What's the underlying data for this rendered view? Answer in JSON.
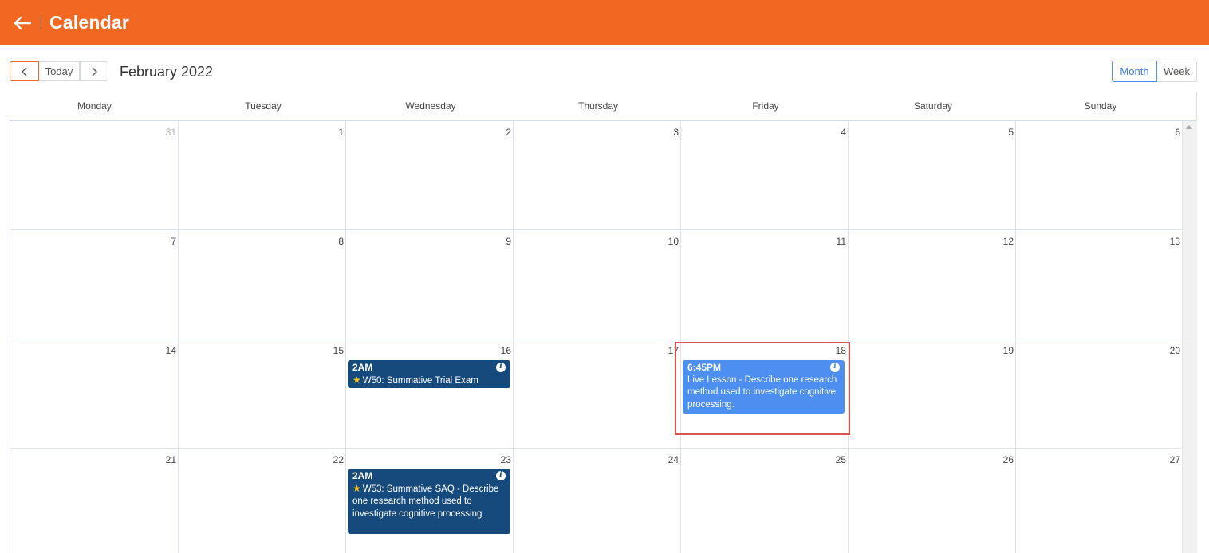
{
  "header": {
    "title": "Calendar",
    "back_icon": "arrow-left-icon",
    "background": "#f26722"
  },
  "toolbar": {
    "prev_icon": "chevron-left-icon",
    "today_label": "Today",
    "next_icon": "chevron-right-icon",
    "month_title": "February 2022",
    "view_month_label": "Month",
    "view_week_label": "Week",
    "active_view": "Month"
  },
  "weekdays": [
    "Monday",
    "Tuesday",
    "Wednesday",
    "Thursday",
    "Friday",
    "Saturday",
    "Sunday"
  ],
  "weeks": [
    [
      "31",
      "1",
      "2",
      "3",
      "4",
      "5",
      "6"
    ],
    [
      "7",
      "8",
      "9",
      "10",
      "11",
      "12",
      "13"
    ],
    [
      "14",
      "15",
      "16",
      "17",
      "18",
      "19",
      "20"
    ],
    [
      "21",
      "22",
      "23",
      "24",
      "25",
      "26",
      "27"
    ]
  ],
  "events": [
    {
      "time": "2AM",
      "title": "W50: Summative Trial Exam",
      "starred": true,
      "day": "16",
      "color": "#174a7c"
    },
    {
      "time": "6:45PM",
      "title": "Live Lesson - Describe one research method used to investigate cognitive processing.",
      "starred": false,
      "day": "18",
      "color": "#4d8ff0"
    },
    {
      "time": "2AM",
      "title": "W53: Summative SAQ - Describe one research method used to investigate cognitive processing",
      "starred": true,
      "day": "23",
      "color": "#174a7c"
    }
  ],
  "icons": {
    "info": "info-icon",
    "star": "star-icon"
  },
  "accent_colors": {
    "highlight_border": "#d9534f",
    "active_view": "#4a8cf0"
  }
}
